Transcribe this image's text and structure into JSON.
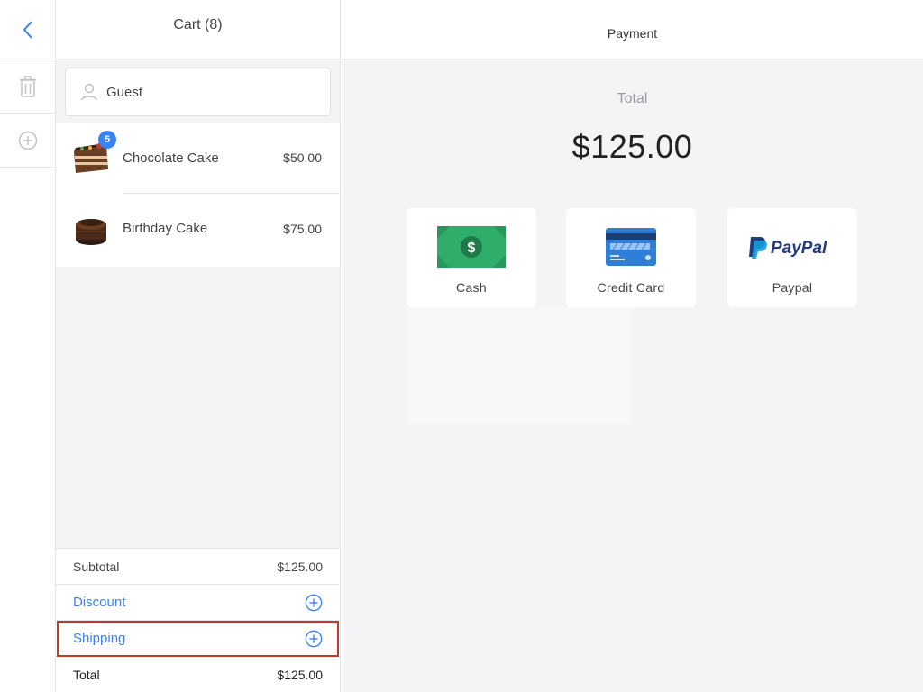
{
  "cart": {
    "title": "Cart (8)",
    "customer": "Guest",
    "items": [
      {
        "name": "Chocolate Cake",
        "price": "$50.00",
        "badge": "5"
      },
      {
        "name": "Birthday Cake",
        "price": "$75.00"
      }
    ],
    "summary": {
      "subtotal_label": "Subtotal",
      "subtotal_value": "$125.00",
      "discount_label": "Discount",
      "shipping_label": "Shipping",
      "total_label": "Total",
      "total_value": "$125.00"
    }
  },
  "payment": {
    "title": "Payment",
    "total_label": "Total",
    "total_amount": "$125.00",
    "methods": [
      {
        "label": "Cash",
        "icon": "cash-icon"
      },
      {
        "label": "Credit Card",
        "icon": "credit-card-icon"
      },
      {
        "label": "Paypal",
        "icon": "paypal-logo",
        "logo_text": "PayPal"
      }
    ]
  },
  "colors": {
    "accent": "#3b82f6",
    "highlight": "#c0392b",
    "cash": "#2fae6b",
    "card": "#2f7fd6",
    "paypal_dark": "#253b80",
    "paypal_light": "#179bd7"
  }
}
